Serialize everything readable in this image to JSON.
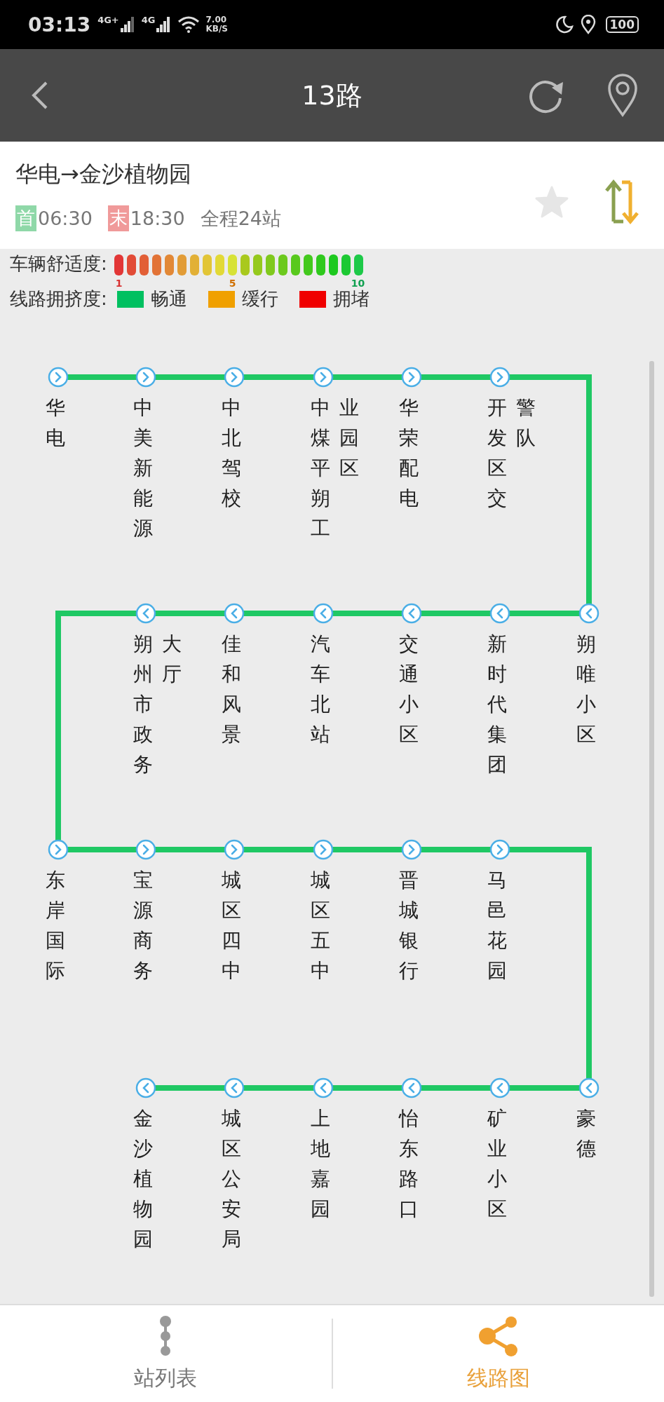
{
  "status_bar": {
    "time": "03:13",
    "network_1": "4G+",
    "network_2": "4G",
    "speed": "7.00",
    "speed_unit": "KB/S",
    "battery": "100"
  },
  "header": {
    "title": "13路"
  },
  "route": {
    "title": "华电→金沙植物园",
    "first_badge": "首",
    "first_time": "06:30",
    "last_badge": "末",
    "last_time": "18:30",
    "total": "全程24站",
    "favorited": false
  },
  "legend": {
    "comfort_label": "车辆舒适度:",
    "comfort_ticks": [
      "1",
      "5",
      "10"
    ],
    "congestion_label": "线路拥挤度:",
    "congestion_items": [
      {
        "label": "畅通",
        "color": "#00c060"
      },
      {
        "label": "缓行",
        "color": "#f0a000"
      },
      {
        "label": "拥堵",
        "color": "#f00000"
      }
    ]
  },
  "map_rows": [
    {
      "kind": "right",
      "stations": [
        "华电",
        "中美新能源",
        "中北驾校",
        "中煤平朔工业园区",
        "华荣配电",
        "开发区交警队"
      ]
    },
    {
      "kind": "left",
      "stations": [
        "朔州市政务大厅",
        "佳和风景",
        "汽车北站",
        "交通小区",
        "新时代集团",
        "朔唯小区"
      ]
    },
    {
      "kind": "right",
      "stations": [
        "东岸国际",
        "宝源商务",
        "城区四中",
        "城区五中",
        "晋城银行",
        "马邑花园"
      ]
    },
    {
      "kind": "left",
      "stations": [
        "金沙植物园",
        "城区公安局",
        "上地嘉园",
        "怡东路口",
        "矿业小区",
        "豪德"
      ]
    }
  ],
  "tabs": [
    {
      "label": "站列表",
      "selected": false
    },
    {
      "label": "线路图",
      "selected": true
    }
  ]
}
